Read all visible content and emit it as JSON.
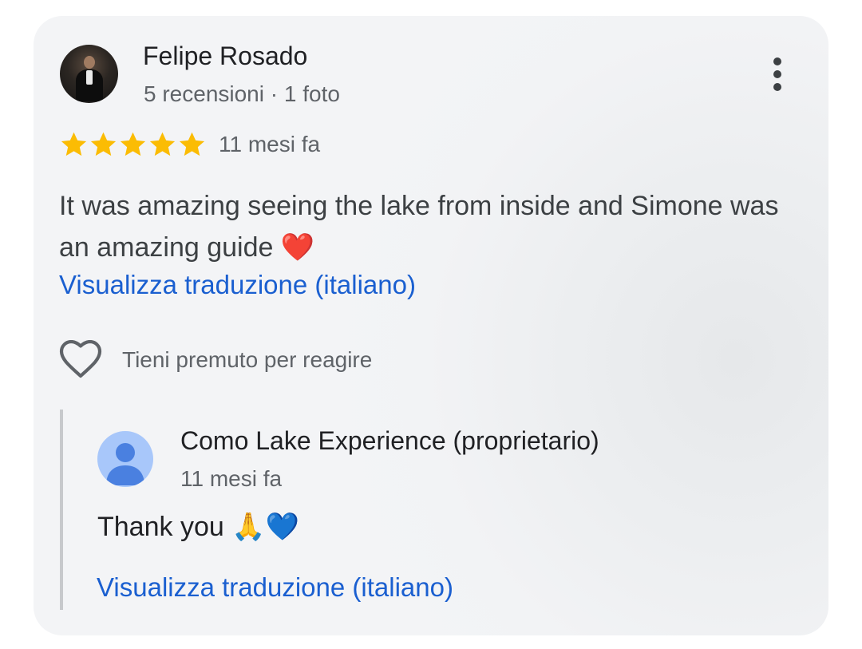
{
  "review": {
    "reviewer_name": "Felipe Rosado",
    "reviewer_meta": "5 recensioni · 1 foto",
    "rating": 5,
    "rating_max": 5,
    "star_color": "#fbbc04",
    "time": "11 mesi fa",
    "text": "It was amazing seeing the lake from inside and Simone was an amazing guide ❤️",
    "translate_link": "Visualizza traduzione (italiano)",
    "react_hint": "Tieni premuto per reagire",
    "more_icon": "more-vertical-icon",
    "react_icon": "heart-outline-icon"
  },
  "owner_reply": {
    "name": "Como Lake Experience (proprietario)",
    "time": "11 mesi fa",
    "text": "Thank you 🙏💙",
    "translate_link": "Visualizza traduzione (italiano)",
    "avatar_icon": "default-person-icon",
    "avatar_color": "#a8c7fa",
    "avatar_figure_color": "#4a80e0"
  },
  "colors": {
    "link": "#1a5fd0",
    "primary_text": "#202124",
    "secondary_text": "#5f6368",
    "card_background": "#f3f4f6"
  }
}
